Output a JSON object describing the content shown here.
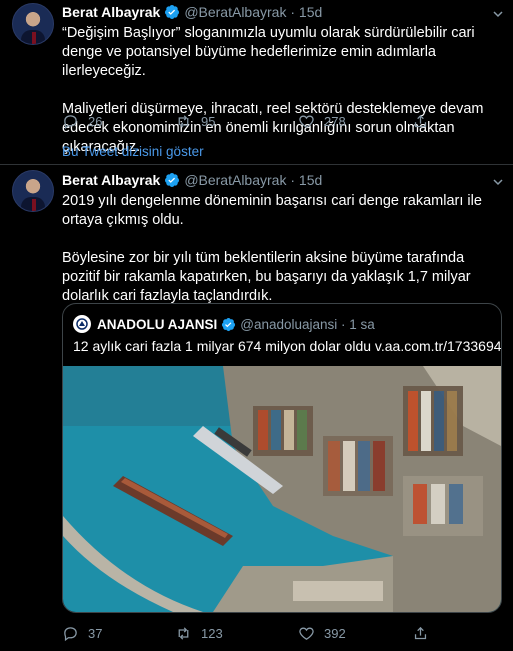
{
  "tweets": [
    {
      "author_name": "Berat Albayrak",
      "author_handle": "@BeratAlbayrak",
      "time": "15d",
      "paragraphs": [
        "“Değişim Başlıyor” sloganımızla uyumlu olarak sürdürülebilir cari denge ve potansiyel büyüme hedeflerimize emin adımlarla ilerleyeceğiz.",
        "Maliyetleri düşürmeye, ihracatı, reel sektörü desteklemeye devam edecek ekonomimizin en önemli kırılganlığını sorun olmaktan çıkaracağız."
      ],
      "replies": "26",
      "retweets": "95",
      "likes": "278",
      "show_thread": "Bu Tweet dizisini göster"
    },
    {
      "author_name": "Berat Albayrak",
      "author_handle": "@BeratAlbayrak",
      "time": "15d",
      "paragraphs": [
        "2019 yılı dengelenme döneminin başarısı cari denge rakamları ile ortaya çıkmış oldu.",
        "Böylesine zor bir yılı tüm beklentilerin aksine büyüme tarafında pozitif bir rakamla kapatırken, bu başarıyı da yaklaşık 1,7 milyar dolarlık cari fazlayla taçlandırdık."
      ],
      "quote": {
        "author_name": "ANADOLU AJANSI",
        "author_handle": "@anadoluajansi",
        "time": "1 sa",
        "text": "12 aylık cari fazla 1 milyar 674 milyon dolar oldu v.aa.com.tr/1733694"
      },
      "replies": "37",
      "retweets": "123",
      "likes": "392"
    }
  ],
  "icons": {
    "reply": "reply-icon",
    "retweet": "retweet-icon",
    "like": "heart-icon",
    "share": "share-icon",
    "verified": "verified-badge-icon",
    "more": "chevron-down-icon"
  },
  "colors": {
    "background": "#000000",
    "text": "#ffffff",
    "secondary": "#8899a6",
    "link": "#4a99e9",
    "divider": "#2f3336",
    "verified": "#1da1f2"
  }
}
